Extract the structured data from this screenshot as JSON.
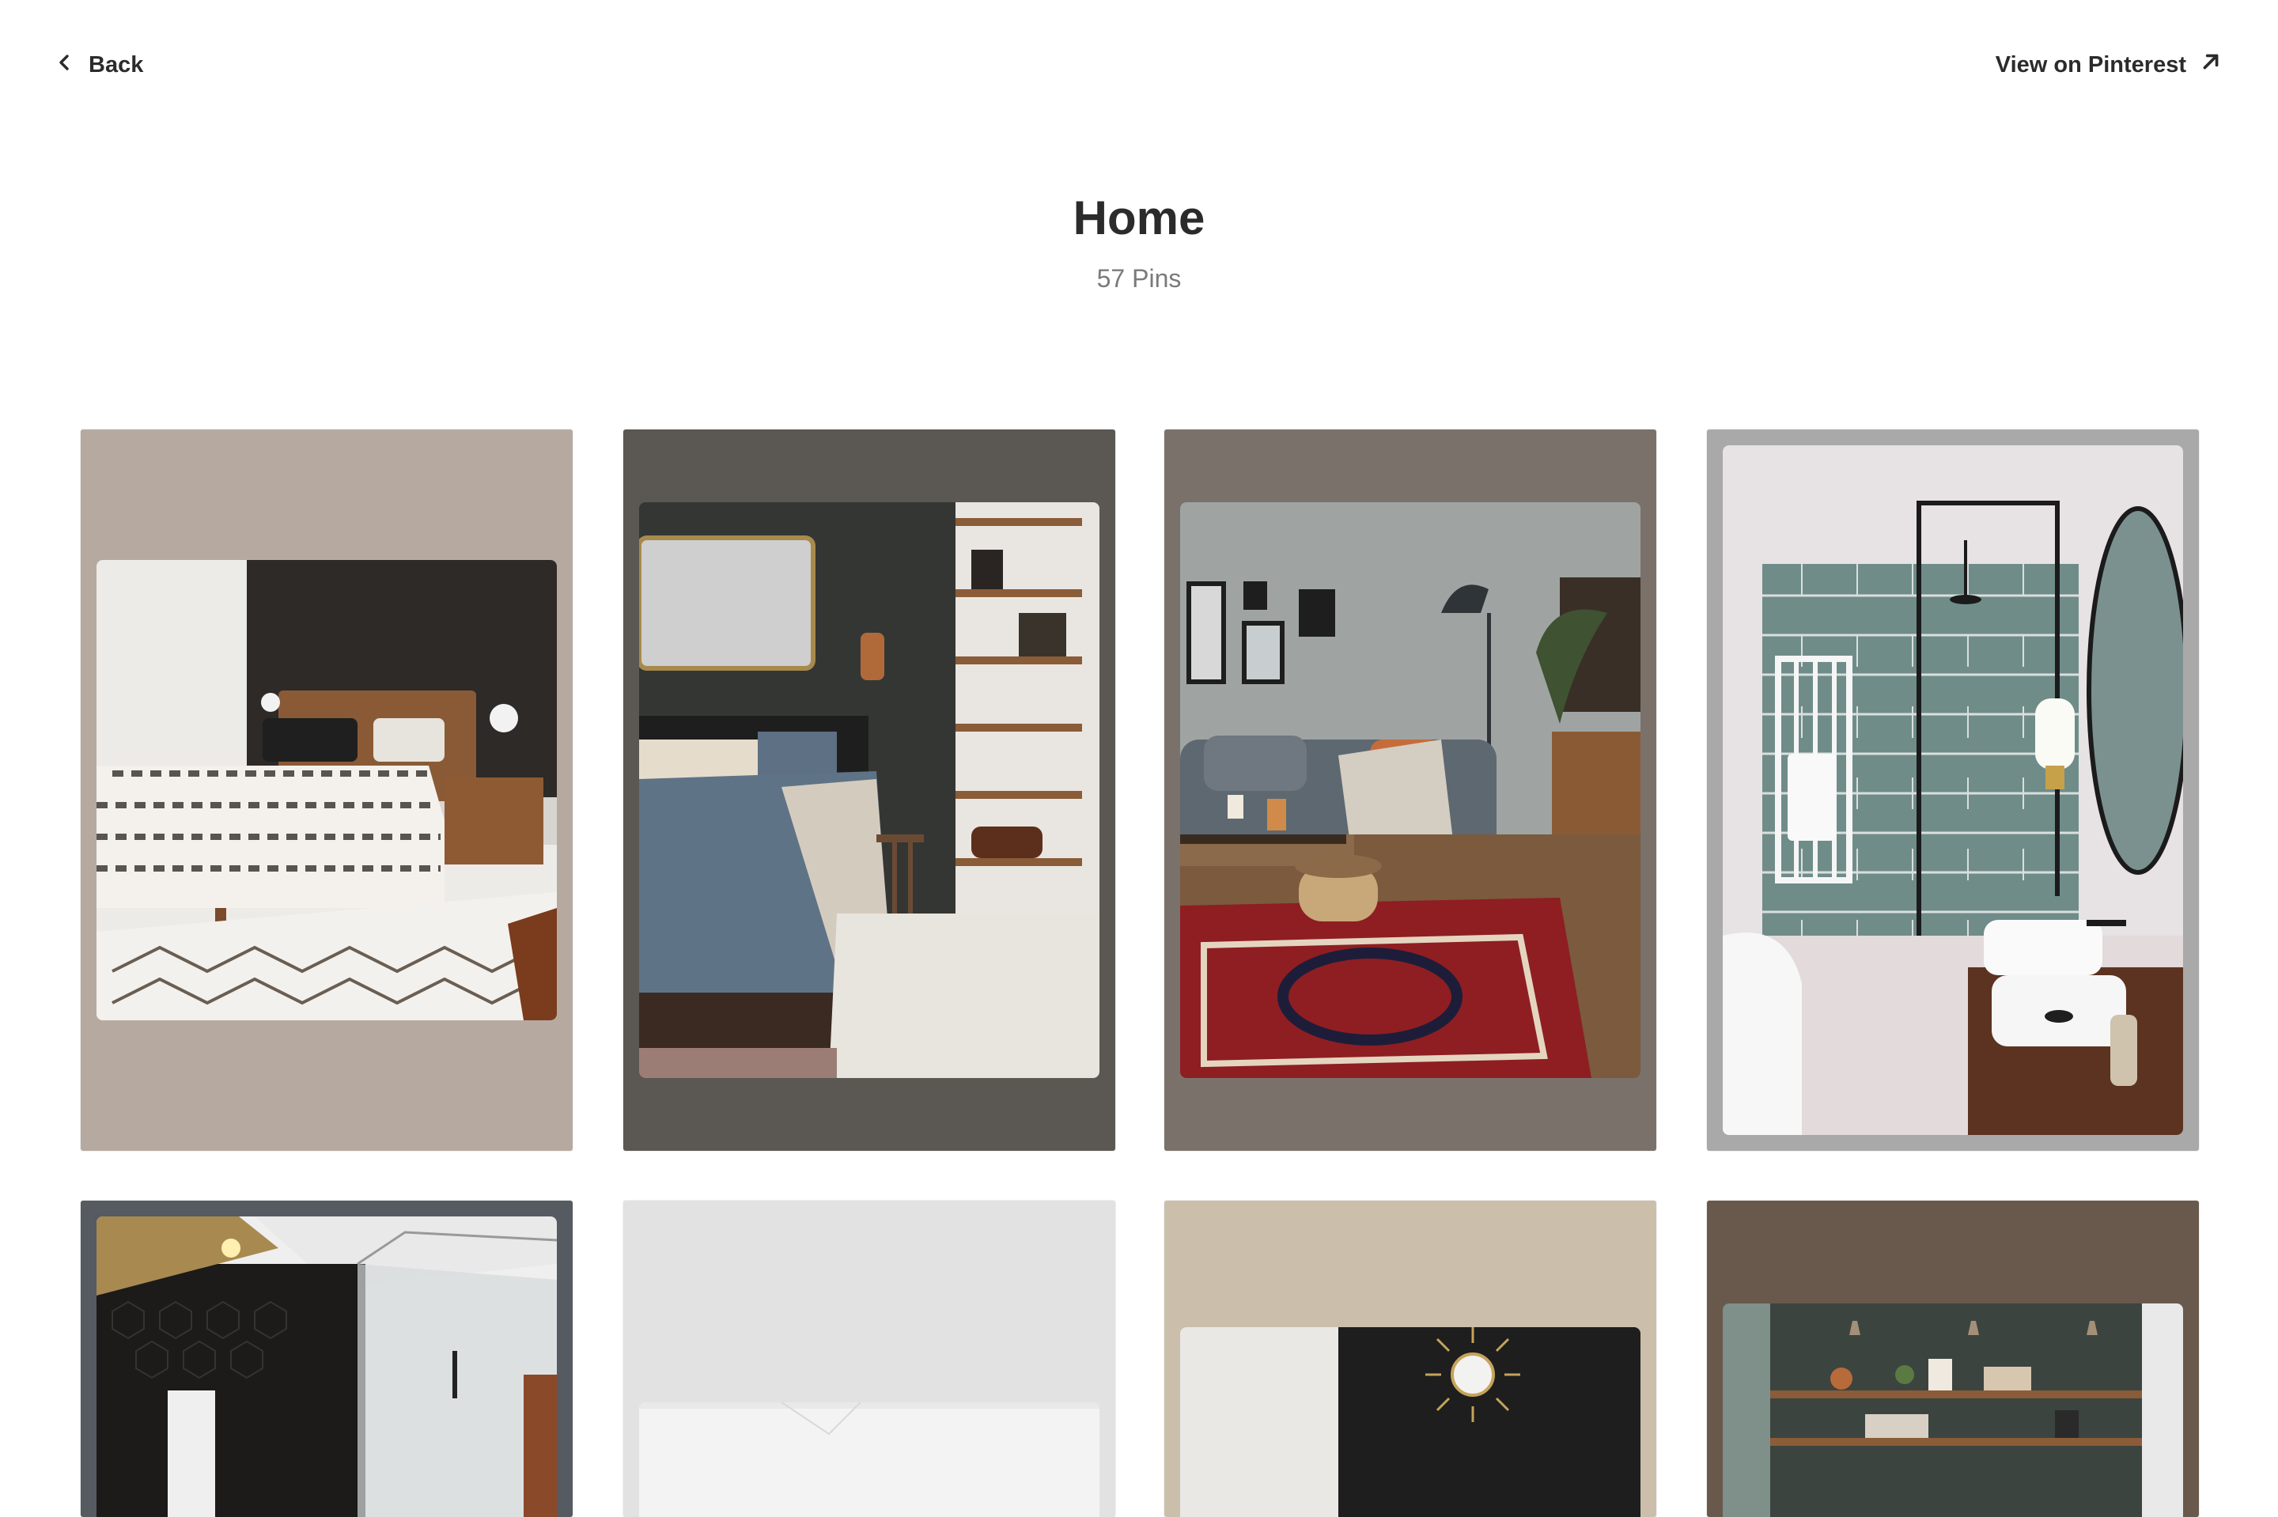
{
  "nav": {
    "back_label": "Back",
    "external_label": "View on Pinterest",
    "back_icon": "chevron-left-icon",
    "external_icon": "arrow-up-right-icon"
  },
  "board": {
    "title": "Home",
    "count": "57 Pins"
  },
  "pins": [
    {
      "subject": "bedroom with dark accent wall and striped bedding",
      "bg_color": "#b6aaa0"
    },
    {
      "subject": "dark bedroom with blue linen bedding and open shelves",
      "bg_color": "#5b5752"
    },
    {
      "subject": "living room with grey sofa and red persian rug",
      "bg_color": "#7a716b"
    },
    {
      "subject": "bathroom with sage green herringbone tile and walk-in shower",
      "bg_color": "#a9a9a9"
    },
    {
      "subject": "bathroom with black hexagon tile and glass shower",
      "bg_color": "#565a61"
    },
    {
      "subject": "light minimal interior",
      "bg_color": "#e2e2e2"
    },
    {
      "subject": "dark wall with gold sunburst mirror",
      "bg_color": "#cbbfab"
    },
    {
      "subject": "dark green kitchen with open shelves",
      "bg_color": "#68594c"
    }
  ]
}
